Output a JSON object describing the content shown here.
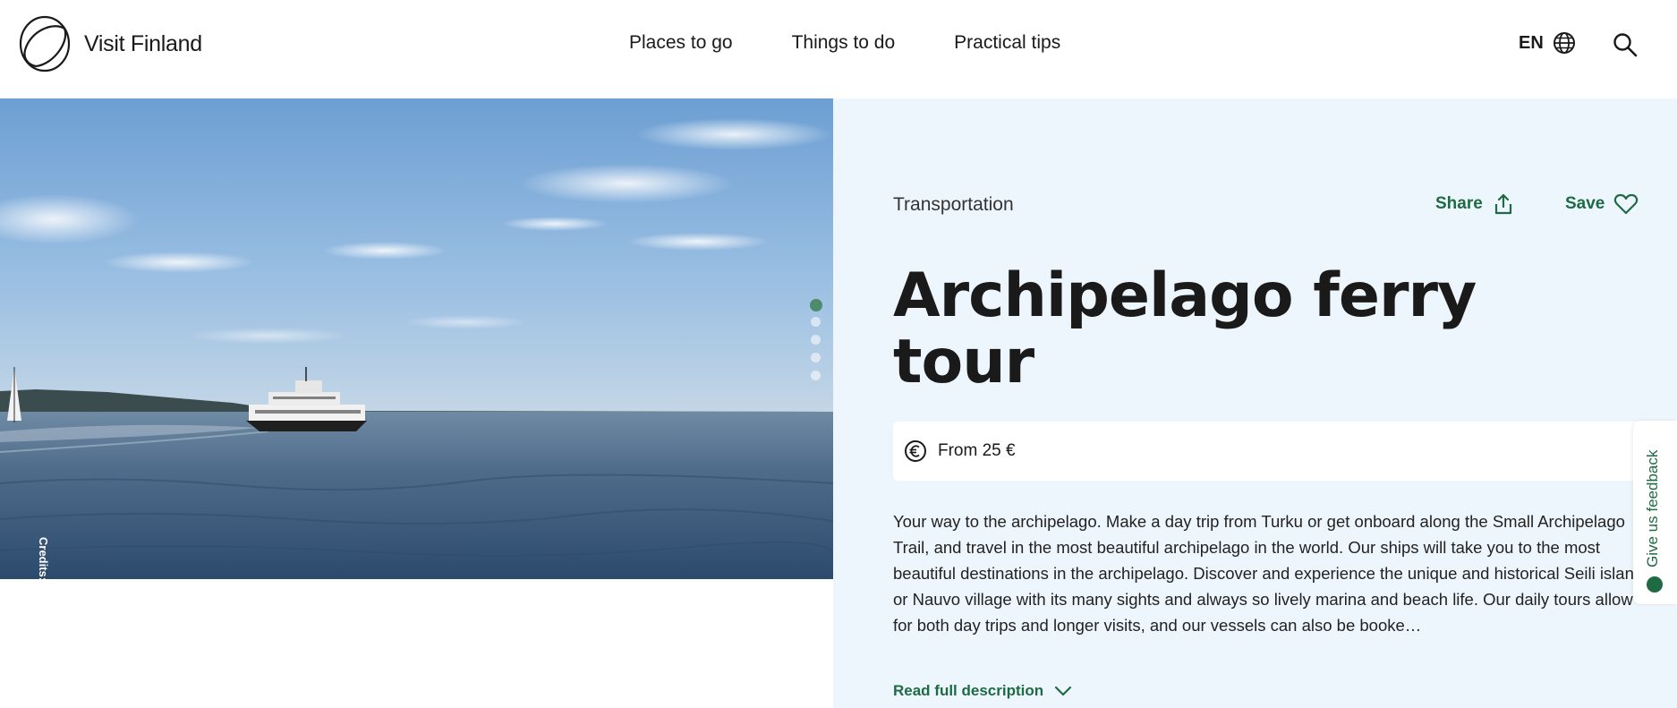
{
  "header": {
    "logo_text": "Visit Finland",
    "nav": [
      "Places to go",
      "Things to do",
      "Practical tips"
    ],
    "language": "EN",
    "icons": {
      "logo": "visit-finland-logo",
      "globe": "globe-icon",
      "search": "search-icon"
    }
  },
  "hero": {
    "credits": "Credits: Viharun",
    "carousel_slides": 5,
    "active_slide": 1
  },
  "article": {
    "category": "Transportation",
    "share_label": "Share",
    "save_label": "Save",
    "title": "Archipelago ferry tour",
    "price": "From 25 €",
    "description": "Your way to the archipelago. Make a day trip from Turku or get onboard along the Small Archipelago Trail, and travel in the most beautiful archipelago in the world. Our ships will take you to the most beautiful destinations in the archipelago. Discover and experience the unique and historical Seili island or Nauvo village with its many sights and always so lively marina and beach life. Our daily tours allow for both day trips and longer visits, and our vessels can also be booke…",
    "read_more": "Read full description"
  },
  "feedback": {
    "label": "Give us feedback"
  },
  "colors": {
    "accent_green": "#1e6b43",
    "panel_bg": "#eef6fd",
    "dot_active": "#4d8c6b"
  }
}
